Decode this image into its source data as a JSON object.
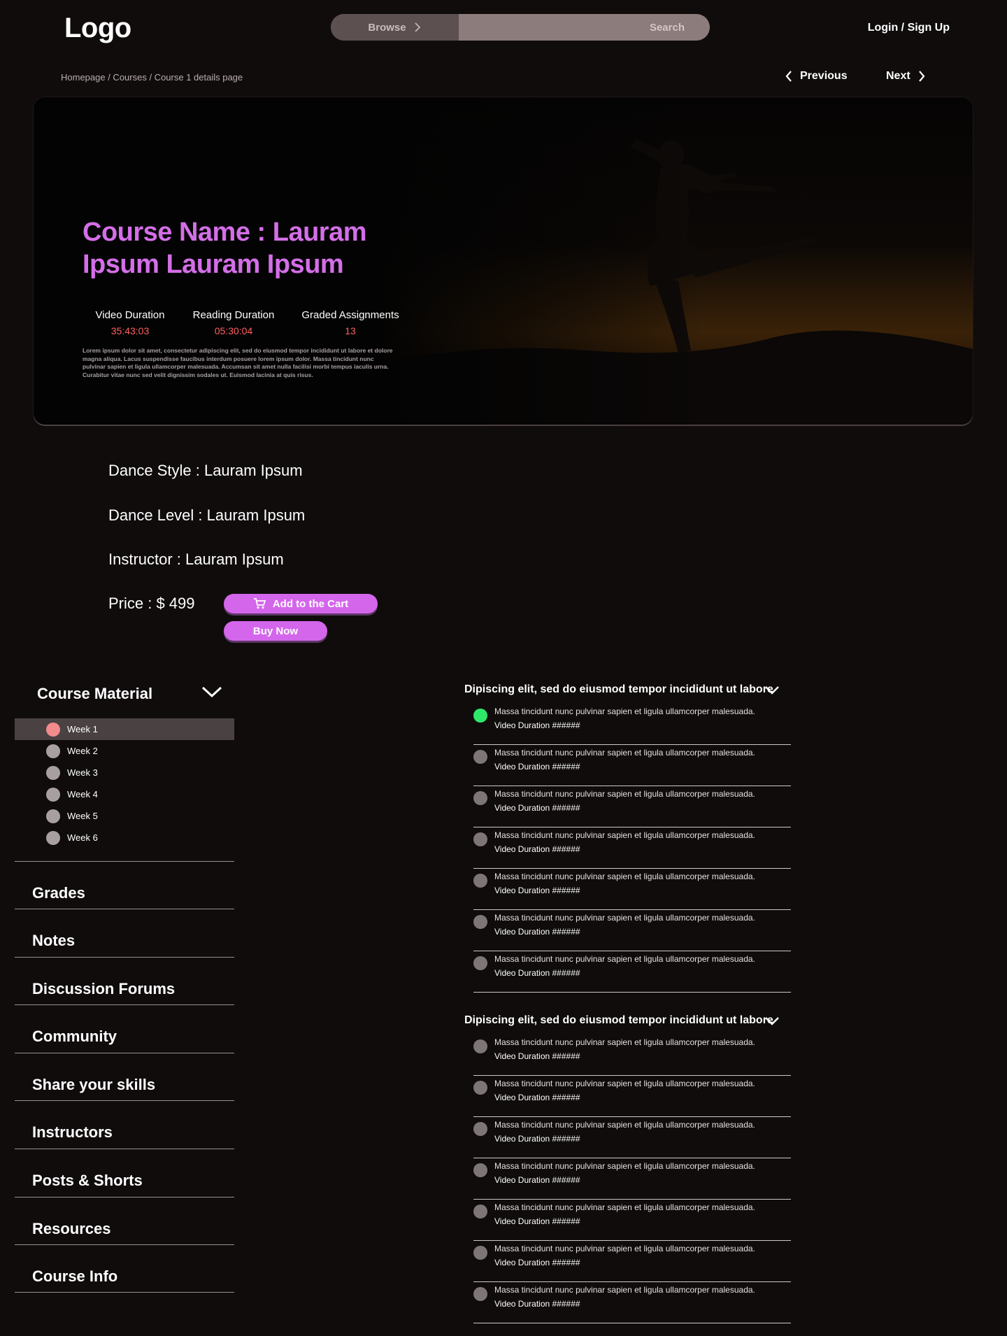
{
  "header": {
    "logo": "Logo",
    "browse_label": "Browse",
    "search_label": "Search",
    "login_label": "Login / Sign Up"
  },
  "breadcrumb": "Homepage / Courses / Course 1 details page",
  "nav": {
    "previous": "Previous",
    "next": "Next"
  },
  "hero": {
    "title": "Course Name : Lauram Ipsum Lauram Ipsum",
    "stats": [
      {
        "label": "Video Duration",
        "value": "35:43:03"
      },
      {
        "label": "Reading Duration",
        "value": "05:30:04"
      },
      {
        "label": "Graded Assignments",
        "value": "13"
      }
    ],
    "description": "Lorem ipsum dolor sit amet, consectetur adipiscing elit, sed do eiusmod tempor incididunt ut labore et dolore magna aliqua. Lacus suspendisse faucibus interdum posuere lorem ipsum dolor. Massa tincidunt nunc pulvinar sapien et ligula ullamcorper malesuada. Accumsan sit amet nulla facilisi morbi tempus iaculis urna. Curabitur vitae nunc sed velit dignissim sodales ut. Euismod lacinia at quis risus."
  },
  "details": {
    "dance_style": "Dance Style :  Lauram Ipsum",
    "dance_level": "Dance Level : Lauram Ipsum",
    "instructor": "Instructor : Lauram Ipsum",
    "price": "Price : $ 499",
    "add_to_cart": "Add to the Cart",
    "buy_now": "Buy Now"
  },
  "sidebar": {
    "course_material": "Course Material",
    "weeks": [
      "Week 1",
      "Week 2",
      "Week 3",
      "Week 4",
      "Week 5",
      "Week 6"
    ],
    "active_week": "Week 1",
    "items": [
      "Grades",
      "Notes",
      "Discussion Forums",
      "Community",
      "Share your skills",
      "Instructors",
      "Posts & Shorts",
      "Resources",
      "Course Info"
    ]
  },
  "sections": [
    {
      "title": "Dipiscing elit, sed do eiusmod tempor incididunt ut labore",
      "lessons": [
        {
          "text": "Massa tincidunt nunc pulvinar sapien et ligula ullamcorper malesuada.",
          "duration": "Video Duration ######",
          "completed": true
        },
        {
          "text": "Massa tincidunt nunc pulvinar sapien et ligula ullamcorper malesuada.",
          "duration": "Video Duration ######",
          "completed": false
        },
        {
          "text": "Massa tincidunt nunc pulvinar sapien et ligula ullamcorper malesuada.",
          "duration": "Video Duration ######",
          "completed": false
        },
        {
          "text": "Massa tincidunt nunc pulvinar sapien et ligula ullamcorper malesuada.",
          "duration": "Video Duration ######",
          "completed": false
        },
        {
          "text": "Massa tincidunt nunc pulvinar sapien et ligula ullamcorper malesuada.",
          "duration": "Video Duration ######",
          "completed": false
        },
        {
          "text": "Massa tincidunt nunc pulvinar sapien et ligula ullamcorper malesuada.",
          "duration": "Video Duration ######",
          "completed": false
        },
        {
          "text": "Massa tincidunt nunc pulvinar sapien et ligula ullamcorper malesuada.",
          "duration": "Video Duration ######",
          "completed": false
        }
      ]
    },
    {
      "title": "Dipiscing elit, sed do eiusmod tempor incididunt ut labore",
      "lessons": [
        {
          "text": "Massa tincidunt nunc pulvinar sapien et ligula ullamcorper malesuada.",
          "duration": "Video Duration ######",
          "completed": false
        },
        {
          "text": "Massa tincidunt nunc pulvinar sapien et ligula ullamcorper malesuada.",
          "duration": "Video Duration ######",
          "completed": false
        },
        {
          "text": "Massa tincidunt nunc pulvinar sapien et ligula ullamcorper malesuada.",
          "duration": "Video Duration ######",
          "completed": false
        },
        {
          "text": "Massa tincidunt nunc pulvinar sapien et ligula ullamcorper malesuada.",
          "duration": "Video Duration ######",
          "completed": false
        },
        {
          "text": "Massa tincidunt nunc pulvinar sapien et ligula ullamcorper malesuada.",
          "duration": "Video Duration ######",
          "completed": false
        },
        {
          "text": "Massa tincidunt nunc pulvinar sapien et ligula ullamcorper malesuada.",
          "duration": "Video Duration ######",
          "completed": false
        },
        {
          "text": "Massa tincidunt nunc pulvinar sapien et ligula ullamcorper malesuada.",
          "duration": "Video Duration ######",
          "completed": false
        }
      ]
    }
  ],
  "colors": {
    "accent": "#d466ec",
    "stat_value": "#ff5f5f",
    "completed": "#2ee86a",
    "active_week_dot": "#f28b8b",
    "background": "#100c0c"
  },
  "icons": {
    "browse": "chevron-right-icon",
    "previous": "chevron-left-icon",
    "next": "chevron-right-icon",
    "cart": "cart-icon",
    "expand": "chevron-down-icon"
  }
}
